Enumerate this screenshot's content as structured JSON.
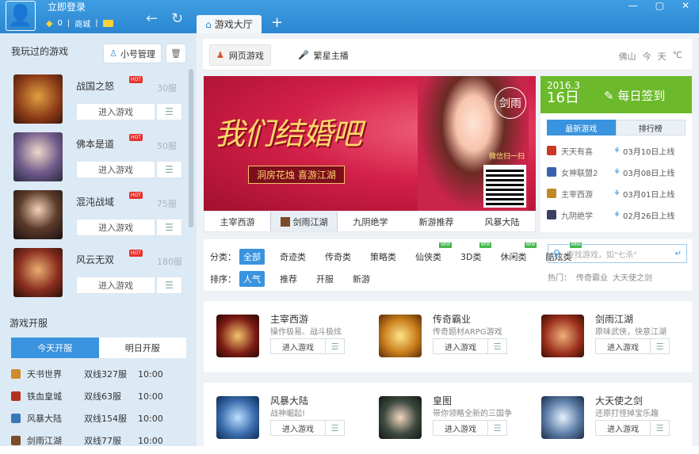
{
  "top": {
    "login": "立即登录",
    "coins": "0",
    "mall": "商城",
    "tab_title": "游戏大厅",
    "add": "+",
    "win": [
      "—",
      "▢",
      "✕"
    ]
  },
  "left": {
    "played_title": "我玩过的游戏",
    "sub_account": "小号管理",
    "games": [
      {
        "name": "战国之怒",
        "server": "30服",
        "enter": "进入游戏",
        "hot": "HOT",
        "color": "#8b3a18"
      },
      {
        "name": "佛本是道",
        "server": "50服",
        "enter": "进入游戏",
        "hot": "HOT",
        "color": "#6f5a8a"
      },
      {
        "name": "混沌战域",
        "server": "75服",
        "enter": "进入游戏",
        "hot": "HOT",
        "color": "#5b3b2a"
      },
      {
        "name": "风云无双",
        "server": "180服",
        "enter": "进入游戏",
        "hot": "HOT",
        "color": "#8a2e20"
      }
    ],
    "open_title": "游戏开服",
    "open_tabs": [
      "今天开服",
      "明日开服"
    ],
    "open_list": [
      {
        "name": "天书世界",
        "server": "双线327服",
        "time": "10:00",
        "color": "#d08a2a"
      },
      {
        "name": "铁血皇城",
        "server": "双线63服",
        "time": "10:00",
        "color": "#b3321f"
      },
      {
        "name": "风暴大陆",
        "server": "双线154服",
        "time": "10:00",
        "color": "#3a78b5"
      },
      {
        "name": "剑雨江湖",
        "server": "双线77服",
        "time": "10:00",
        "color": "#7b4b2a"
      }
    ]
  },
  "main": {
    "filterbar": {
      "web": "网页游戏",
      "live": "繁星主播",
      "weather": [
        "佛山",
        "今",
        "天",
        "℃"
      ]
    },
    "banner": {
      "title": "我们结婚吧",
      "subtitle": "洞房花烛 喜游江湖",
      "logo": "剑雨",
      "wechat": "微信扫一扫",
      "tabs": [
        "主宰西游",
        "剑雨江湖",
        "九阴绝学",
        "新游推荐",
        "风暴大陆"
      ]
    },
    "signin": {
      "month": "2016.3",
      "day": "16日",
      "label": "每日签到"
    },
    "news": {
      "tabs": [
        "最新游戏",
        "排行榜"
      ],
      "items": [
        {
          "name": "天天有喜",
          "date": "03月10日上线",
          "color": "#c83a24"
        },
        {
          "name": "女神联盟2",
          "date": "03月08日上线",
          "color": "#3a5fb0"
        },
        {
          "name": "主宰西游",
          "date": "03月01日上线",
          "color": "#c0872b"
        },
        {
          "name": "九阴绝学",
          "date": "02月26日上线",
          "color": "#3b3f66"
        }
      ]
    },
    "filter": {
      "cat_label": "分类：",
      "cats": [
        "全部",
        "奇迹类",
        "传奇类",
        "策略类",
        "仙侠类",
        "3D类",
        "休闲类",
        "酷炫类"
      ],
      "sort_label": "排序：",
      "sorts": [
        "人气",
        "推荐",
        "开服",
        "新游"
      ],
      "search_placeholder": "查找游戏，如\"七杀\"",
      "hot_label": "热门：",
      "hot_items": [
        "传奇霸业",
        "大天使之剑"
      ]
    },
    "cards": [
      {
        "title": "主宰西游",
        "desc": "操作极易、战斗极炫",
        "enter": "进入游戏",
        "color": "#7a1a14"
      },
      {
        "title": "传奇霸业",
        "desc": "传奇题材ARPG游戏",
        "enter": "进入游戏",
        "color": "#c9801c"
      },
      {
        "title": "剑雨江湖",
        "desc": "原味武侠，快意江湖",
        "enter": "进入游戏",
        "color": "#9a2f1c"
      },
      {
        "title": "风暴大陆",
        "desc": "战神崛起!",
        "enter": "进入游戏",
        "color": "#3c6fb0"
      },
      {
        "title": "皇图",
        "desc": "带你领略全新的三国争",
        "enter": "进入游戏",
        "color": "#3e4a40"
      },
      {
        "title": "大天使之剑",
        "desc": "还原打怪掉宝乐趣",
        "enter": "进入游戏",
        "color": "#5e7fa8"
      }
    ]
  }
}
